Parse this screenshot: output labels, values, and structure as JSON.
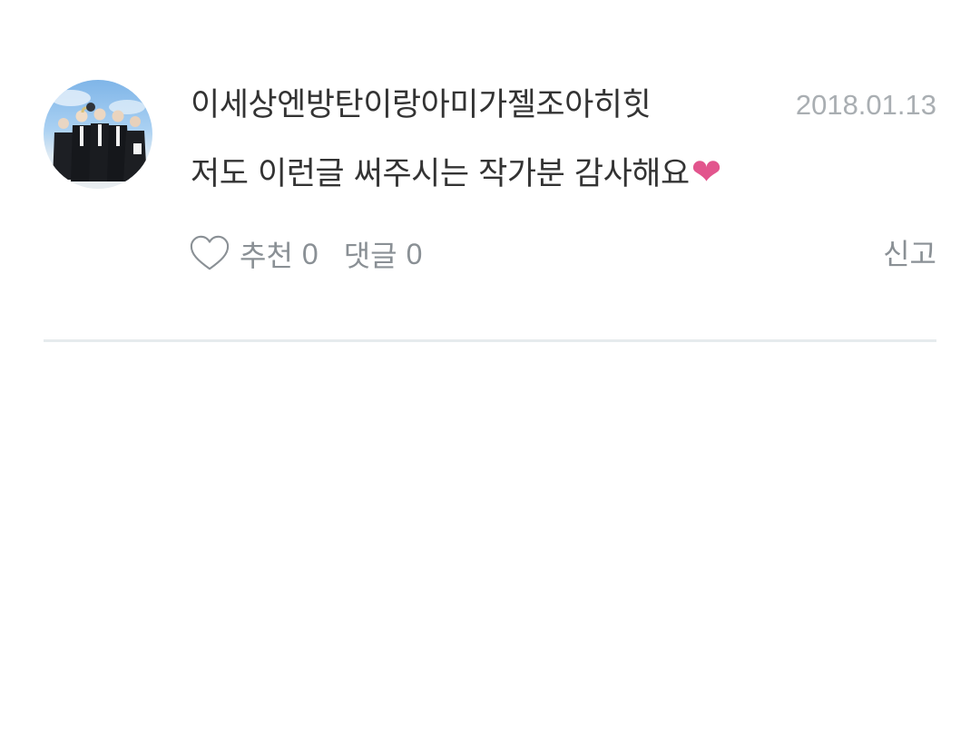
{
  "comment": {
    "author": "이세상엔방탄이랑아미가젤조아히힛",
    "date": "2018.01.13",
    "text": "저도 이런글 써주시는 작가분 감사해요",
    "text_emoji": "❤",
    "like_label": "추천",
    "like_count": "0",
    "reply_label": "댓글",
    "reply_count": "0",
    "report_label": "신고",
    "avatar_icon": "profile-photo"
  },
  "colors": {
    "text": "#333333",
    "muted": "#8a9095",
    "date": "#a9aeb2",
    "heart": "#e2558d",
    "divider": "#e6ebed"
  }
}
